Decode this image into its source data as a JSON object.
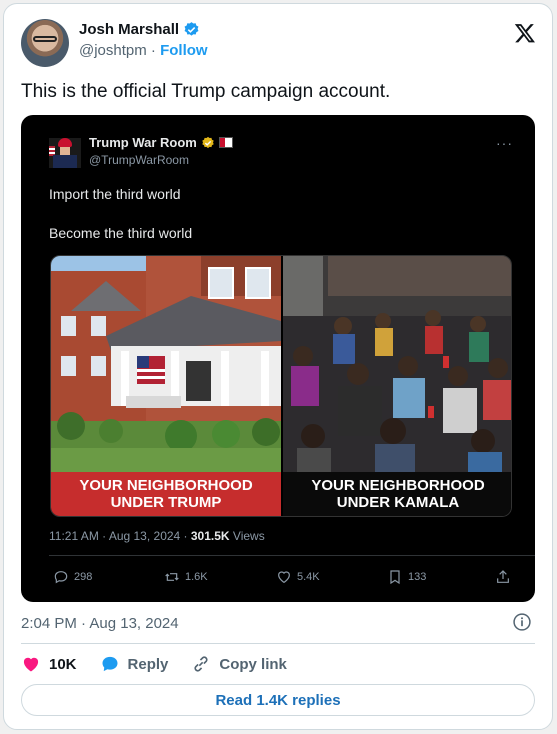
{
  "author": {
    "name": "Josh Marshall",
    "handle": "@joshtpm",
    "separator": "·",
    "follow_label": "Follow"
  },
  "tweet": {
    "text": "This is the official Trump campaign account."
  },
  "quoted": {
    "name": "Trump War Room",
    "handle": "@TrumpWarRoom",
    "more_label": "···",
    "line1": "Import the third world",
    "line2": "Become the third world",
    "image": {
      "left_caption_line1": "YOUR NEIGHBORHOOD",
      "left_caption_line2": "UNDER TRUMP",
      "right_caption_line1": "YOUR NEIGHBORHOOD",
      "right_caption_line2": "UNDER KAMALA"
    },
    "meta_time": "11:21 AM · Aug 13, 2024 · ",
    "meta_views_count": "301.5K",
    "meta_views_label": " Views",
    "actions": {
      "replies": "298",
      "reposts": "1.6K",
      "likes": "5.4K",
      "bookmarks": "133"
    }
  },
  "timestamp": "2:04 PM · Aug 13, 2024",
  "actions": {
    "likes": "10K",
    "reply_label": "Reply",
    "copy_link_label": "Copy link"
  },
  "read_replies_label": "Read 1.4K replies",
  "colors": {
    "accent": "#1d9bf0",
    "like": "#f91880",
    "caption_red": "#c62d2d"
  }
}
